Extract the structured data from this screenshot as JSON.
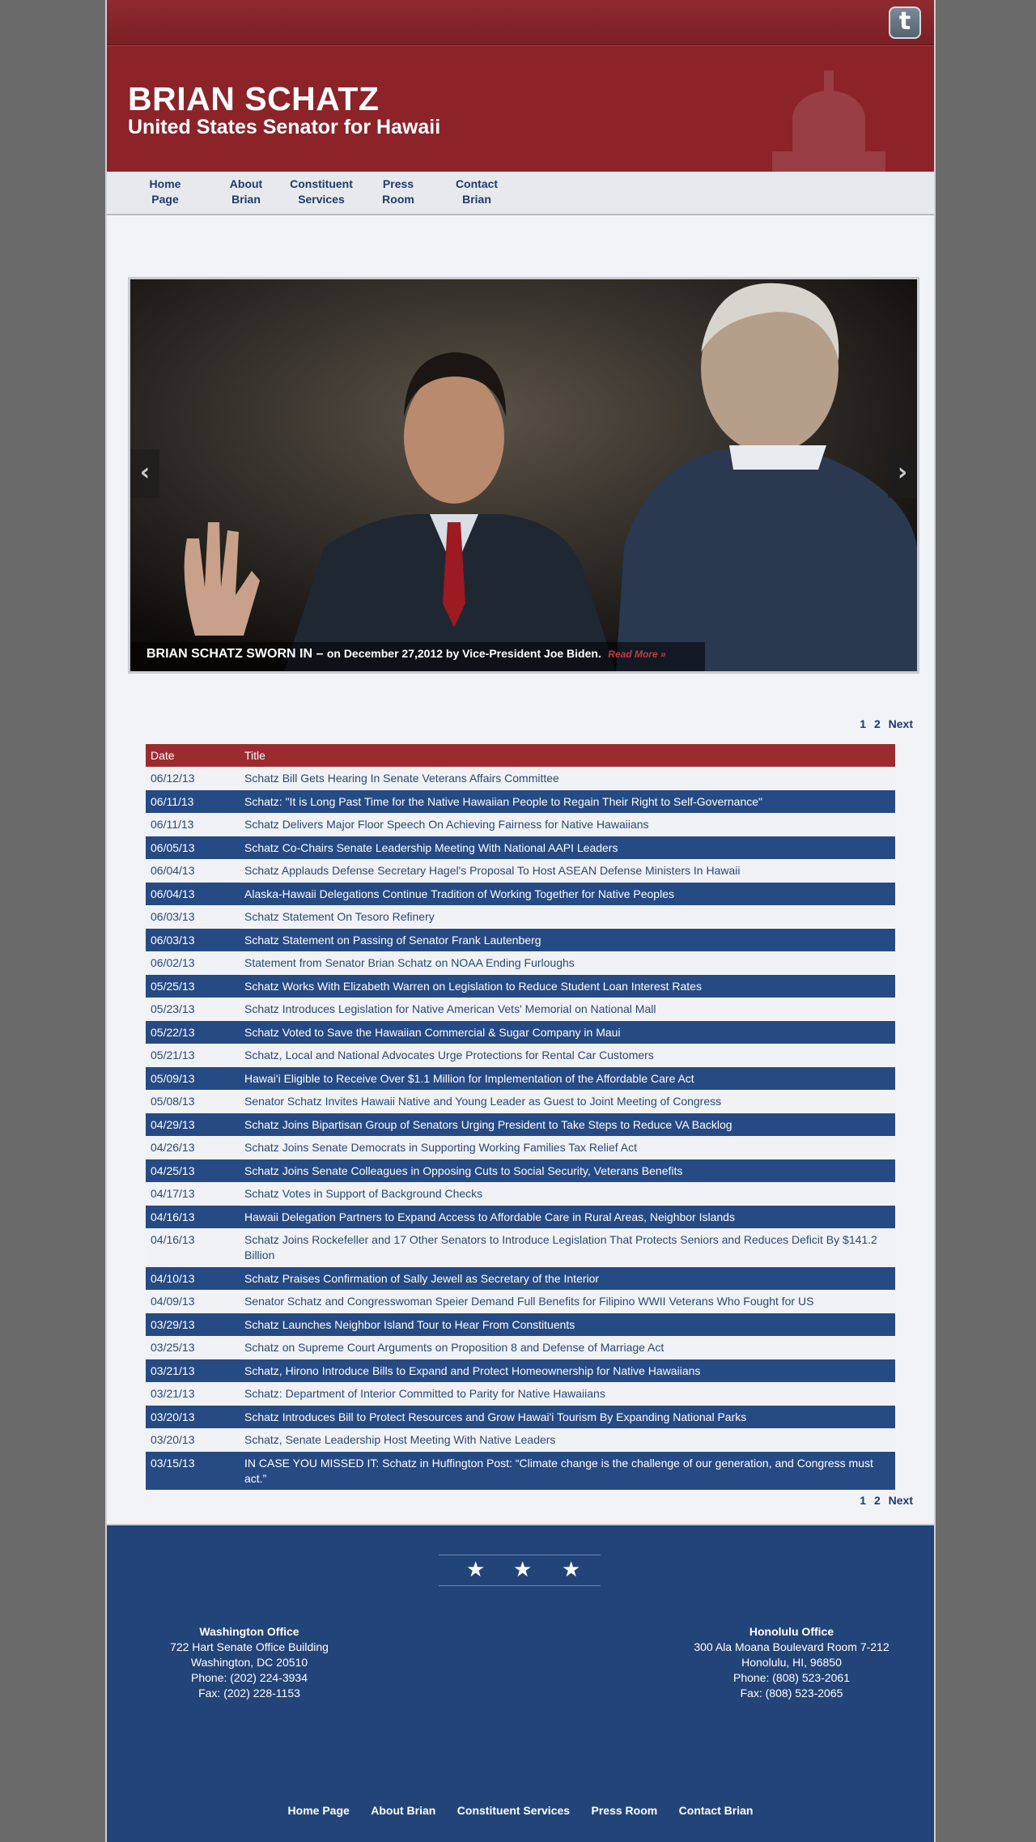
{
  "header": {
    "title": "BRIAN SCHATZ",
    "subtitle": "United States Senator for Hawaii",
    "twitter_icon": "twitter-icon"
  },
  "nav": [
    {
      "line1": "Home",
      "line2": "Page"
    },
    {
      "line1": "About",
      "line2": "Brian"
    },
    {
      "line1": "Constituent",
      "line2": "Services"
    },
    {
      "line1": "Press",
      "line2": "Room"
    },
    {
      "line1": "Contact",
      "line2": "Brian"
    }
  ],
  "slider": {
    "headline": "BRIAN SCHATZ SWORN IN –",
    "text": "on December 27,2012 by Vice-President Joe Biden.",
    "read_more": "Read More »",
    "prev": "‹",
    "next": "›"
  },
  "pager": {
    "page1": "1",
    "page2": "2",
    "next": "Next"
  },
  "table": {
    "col_date": "Date",
    "col_title": "Title",
    "rows": [
      {
        "date": "06/12/13",
        "title": "Schatz Bill Gets Hearing In Senate Veterans Affairs Committee"
      },
      {
        "date": "06/11/13",
        "title": "Schatz: \"It is Long Past Time for the Native Hawaiian People to Regain Their Right to Self-Governance\""
      },
      {
        "date": "06/11/13",
        "title": "Schatz Delivers Major Floor Speech On Achieving Fairness for Native Hawaiians"
      },
      {
        "date": "06/05/13",
        "title": "Schatz Co-Chairs Senate Leadership Meeting With National AAPI Leaders"
      },
      {
        "date": "06/04/13",
        "title": "Schatz Applauds Defense Secretary Hagel's Proposal To Host ASEAN Defense Ministers In Hawaii"
      },
      {
        "date": "06/04/13",
        "title": "Alaska-Hawaii Delegations Continue Tradition of Working Together for Native Peoples"
      },
      {
        "date": "06/03/13",
        "title": "Schatz Statement On Tesoro Refinery"
      },
      {
        "date": "06/03/13",
        "title": "Schatz Statement on Passing of Senator Frank Lautenberg"
      },
      {
        "date": "06/02/13",
        "title": "Statement from Senator Brian Schatz on NOAA Ending Furloughs"
      },
      {
        "date": "05/25/13",
        "title": "Schatz Works With Elizabeth Warren on Legislation to Reduce Student Loan Interest Rates"
      },
      {
        "date": "05/23/13",
        "title": "Schatz Introduces Legislation for Native American Vets' Memorial on National Mall"
      },
      {
        "date": "05/22/13",
        "title": "Schatz Voted to Save the Hawaiian Commercial & Sugar Company in Maui"
      },
      {
        "date": "05/21/13",
        "title": "Schatz, Local and National Advocates Urge Protections for Rental Car Customers"
      },
      {
        "date": "05/09/13",
        "title": "Hawai'i Eligible to Receive Over $1.1 Million for Implementation of the Affordable Care Act"
      },
      {
        "date": "05/08/13",
        "title": "Senator Schatz Invites Hawaii Native and Young Leader as Guest to Joint Meeting of Congress"
      },
      {
        "date": "04/29/13",
        "title": "Schatz Joins Bipartisan Group of Senators Urging President to Take Steps to Reduce VA Backlog"
      },
      {
        "date": "04/26/13",
        "title": "Schatz Joins Senate Democrats in Supporting Working Families Tax Relief Act"
      },
      {
        "date": "04/25/13",
        "title": "Schatz Joins Senate Colleagues in Opposing Cuts to Social Security, Veterans Benefits"
      },
      {
        "date": "04/17/13",
        "title": "Schatz Votes in Support of Background Checks"
      },
      {
        "date": "04/16/13",
        "title": "Hawaii Delegation Partners to Expand Access to Affordable Care in Rural Areas, Neighbor Islands"
      },
      {
        "date": "04/16/13",
        "title": "Schatz Joins Rockefeller and 17 Other Senators to Introduce Legislation That Protects Seniors and Reduces Deficit By $141.2 Billion"
      },
      {
        "date": "04/10/13",
        "title": "Schatz Praises Confirmation of Sally Jewell as Secretary of the Interior"
      },
      {
        "date": "04/09/13",
        "title": "Senator Schatz and Congresswoman Speier Demand Full Benefits for Filipino WWII Veterans Who Fought for US"
      },
      {
        "date": "03/29/13",
        "title": "Schatz Launches Neighbor Island Tour to Hear From Constituents"
      },
      {
        "date": "03/25/13",
        "title": "Schatz on Supreme Court Arguments on Proposition 8 and Defense of Marriage Act"
      },
      {
        "date": "03/21/13",
        "title": "Schatz, Hirono Introduce Bills to Expand and Protect Homeownership for Native Hawaiians"
      },
      {
        "date": "03/21/13",
        "title": "Schatz: Department of Interior Committed to Parity for Native Hawaiians"
      },
      {
        "date": "03/20/13",
        "title": "Schatz Introduces Bill to Protect Resources and Grow Hawai'i Tourism By Expanding National Parks"
      },
      {
        "date": "03/20/13",
        "title": "Schatz, Senate Leadership Host Meeting With Native Leaders"
      },
      {
        "date": "03/15/13",
        "title": "IN CASE YOU MISSED IT: Schatz in Huffington Post: “Climate change is the challenge of our generation, and Congress must act.”"
      }
    ]
  },
  "footer": {
    "star": "★",
    "dc_office": {
      "name": "Washington Office",
      "line1": "722 Hart Senate Office Building",
      "line2": "Washington, DC 20510",
      "phone": "Phone: (202) 224-3934",
      "fax": "Fax: (202) 228-1153"
    },
    "hi_office": {
      "name": "Honolulu Office",
      "line1": "300 Ala Moana Boulevard Room 7-212",
      "line2": "Honolulu, HI, 96850",
      "phone": "Phone: (808) 523-2061",
      "fax": "Fax: (808) 523-2065"
    },
    "links": [
      "Home Page",
      "About Brian",
      "Constituent Services",
      "Press Room",
      "Contact Brian"
    ]
  },
  "colors": {
    "header_red": "#8b2329",
    "row_blue": "#264a84",
    "footer_blue": "#234479",
    "link_blue": "#1f3a6b"
  }
}
